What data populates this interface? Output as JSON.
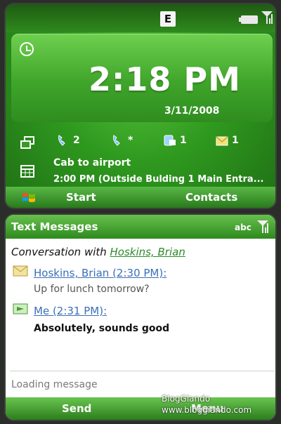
{
  "home_screen": {
    "status": {
      "network_badge": "E"
    },
    "clock": {
      "time": "2:18 PM",
      "date": "3/11/2008"
    },
    "notifications": [
      {
        "icon": "missed-call-icon",
        "count": "2"
      },
      {
        "icon": "voicemail-icon",
        "count": "*"
      },
      {
        "icon": "text-message-icon",
        "count": "1"
      },
      {
        "icon": "email-icon",
        "count": "1"
      }
    ],
    "appointment": {
      "title": "Cab to airport",
      "detail": "2:00 PM (Outside Bulding 1 Main Entra..."
    },
    "softkeys": {
      "left": "Start",
      "right": "Contacts"
    }
  },
  "messaging_screen": {
    "title": "Text Messages",
    "input_mode": "abc",
    "conversation_prefix": "Conversation with ",
    "conversation_name": "Hoskins, Brian",
    "messages": [
      {
        "sender": "Hoskins, Brian (2:30 PM):",
        "body": "Up for lunch tomorrow?"
      },
      {
        "sender": "Me (2:31 PM):",
        "body": "Absolutely, sounds good"
      }
    ],
    "status_text": "Loading message",
    "softkeys": {
      "left": "Send",
      "right": "Menu"
    }
  },
  "watermark": {
    "line1": "BlogGlando",
    "line2": "www.bloggiando.com"
  },
  "colors": {
    "accent_green": "#2e8a1e",
    "link_blue": "#3b6fb8"
  }
}
